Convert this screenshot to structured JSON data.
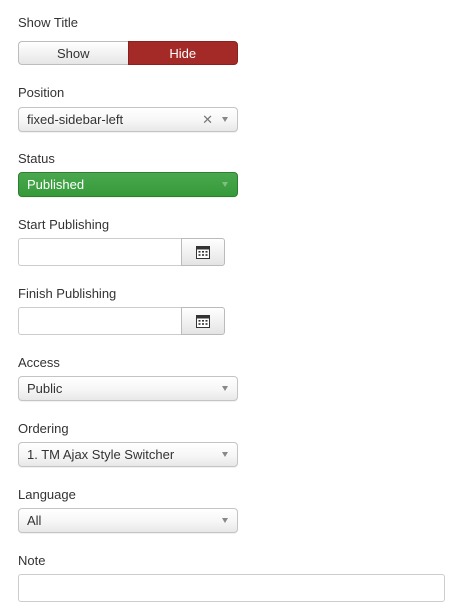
{
  "show_title": {
    "label": "Show Title",
    "options": [
      "Show",
      "Hide"
    ],
    "selected": "Hide"
  },
  "position": {
    "label": "Position",
    "value": "fixed-sidebar-left",
    "clear_glyph": "✕"
  },
  "status": {
    "label": "Status",
    "value": "Published",
    "color": "#3a9d3e"
  },
  "start_publishing": {
    "label": "Start Publishing",
    "value": ""
  },
  "finish_publishing": {
    "label": "Finish Publishing",
    "value": ""
  },
  "access": {
    "label": "Access",
    "value": "Public"
  },
  "ordering": {
    "label": "Ordering",
    "value": "1. TM Ajax Style Switcher"
  },
  "language": {
    "label": "Language",
    "value": "All"
  },
  "note": {
    "label": "Note",
    "value": ""
  },
  "icons": {
    "calendar": "calendar-icon",
    "caret": "chevron-down-icon",
    "clear": "close-icon"
  },
  "colors": {
    "hide_active": "#a32a26",
    "published": "#3a9d3e"
  }
}
